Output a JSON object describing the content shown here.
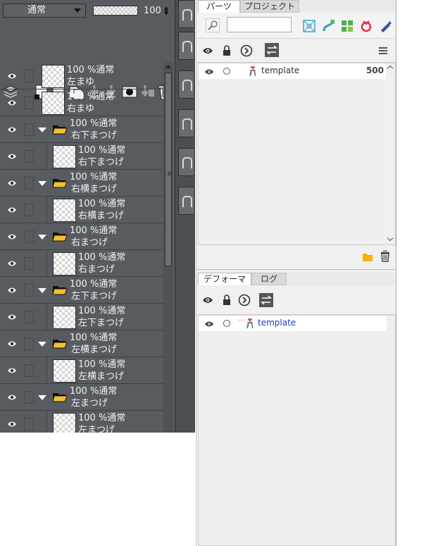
{
  "layers_panel": {
    "blend_mode": "通常",
    "opacity_value": "100",
    "opacity_fraction": 1.0,
    "layers": [
      {
        "kind": "layer",
        "percent_mode": "100 %通常",
        "name": "左まゆ"
      },
      {
        "kind": "layer",
        "percent_mode": "100 %通常",
        "name": "右まゆ"
      },
      {
        "kind": "folder",
        "percent_mode": "100 %通常",
        "name": "右下まつげ"
      },
      {
        "kind": "child",
        "percent_mode": "100 %通常",
        "name": "右下まつげ"
      },
      {
        "kind": "folder",
        "percent_mode": "100 %通常",
        "name": "右横まつげ"
      },
      {
        "kind": "child",
        "percent_mode": "100 %通常",
        "name": "右横まつげ"
      },
      {
        "kind": "folder",
        "percent_mode": "100 %通常",
        "name": "右まつげ"
      },
      {
        "kind": "child",
        "percent_mode": "100 %通常",
        "name": "右まつげ"
      },
      {
        "kind": "folder",
        "percent_mode": "100 %通常",
        "name": "左下まつげ"
      },
      {
        "kind": "child",
        "percent_mode": "100 %通常",
        "name": "左下まつげ"
      },
      {
        "kind": "folder",
        "percent_mode": "100 %通常",
        "name": "左横まつげ"
      },
      {
        "kind": "child",
        "percent_mode": "100 %通常",
        "name": "左横まつげ"
      },
      {
        "kind": "folder",
        "percent_mode": "100 %通常",
        "name": "左まつげ"
      },
      {
        "kind": "child",
        "percent_mode": "100 %通常",
        "name": "左まつげ"
      }
    ]
  },
  "parts_panel": {
    "tabs": [
      {
        "label": "パーツ",
        "active": true
      },
      {
        "label": "プロジェクト",
        "active": false
      }
    ],
    "search_value": "",
    "rows": [
      {
        "name": "template",
        "count": "500"
      }
    ]
  },
  "deformer_panel": {
    "tabs": [
      {
        "label": "デフォーマ",
        "active": true
      },
      {
        "label": "ログ",
        "active": false
      }
    ],
    "rows": [
      {
        "prefix": "···",
        "name": "template"
      }
    ]
  },
  "icons": {
    "eye": "eye-icon",
    "lock": "lock-icon",
    "next": "chevron-right-circle-icon",
    "swap": "swap-icon",
    "menu": "hamburger-menu-icon",
    "folder": "folder-icon",
    "trash": "trash-icon"
  },
  "colors": {
    "layer_panel_bg": "#585c61",
    "right_panel_bg": "#f0f0f0",
    "link_blue": "#1a3cc7",
    "folder_yellow": "#f2c12e"
  }
}
